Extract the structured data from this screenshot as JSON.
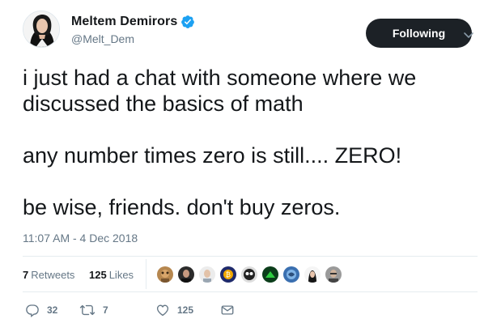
{
  "author": {
    "display_name": "Meltem Demirors",
    "handle": "@Melt_Dem",
    "verified": true
  },
  "follow_button": {
    "label": "Following"
  },
  "tweet": {
    "lines": [
      "i just had a chat with someone where we",
      "discussed the basics of math",
      "any number times zero is still.... ZERO!",
      "be wise, friends. don't buy zeros."
    ],
    "timestamp": "11:07 AM - 4 Dec 2018"
  },
  "stats": {
    "retweets_count": "7",
    "retweets_label": "Retweets",
    "likes_count": "125",
    "likes_label": "Likes"
  },
  "likers": [
    {
      "icon": "liker-avatar-1"
    },
    {
      "icon": "liker-avatar-2"
    },
    {
      "icon": "liker-avatar-3"
    },
    {
      "icon": "liker-avatar-4"
    },
    {
      "icon": "liker-avatar-5"
    },
    {
      "icon": "liker-avatar-6"
    },
    {
      "icon": "liker-avatar-7"
    },
    {
      "icon": "liker-avatar-8"
    },
    {
      "icon": "liker-avatar-9"
    }
  ],
  "actions": {
    "reply_count": "32",
    "retweet_count": "7",
    "like_count": "125"
  },
  "colors": {
    "text": "#14171a",
    "secondary": "#657786",
    "verified": "#1da1f2",
    "button_bg": "#1c2126",
    "divider": "#e6ecf0"
  }
}
